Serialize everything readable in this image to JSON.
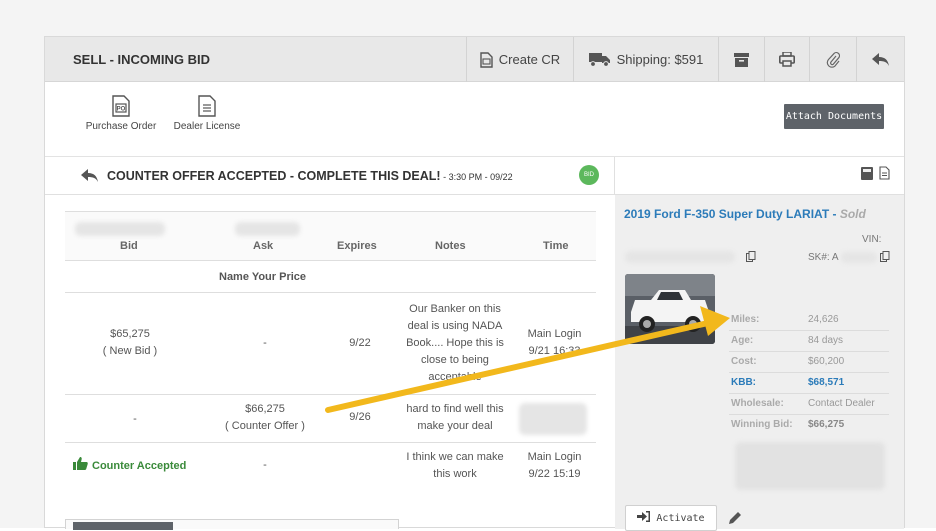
{
  "header": {
    "title": "SELL - INCOMING BID",
    "create_cr": "Create CR",
    "shipping": "Shipping: $591"
  },
  "docs": {
    "purchase_order": "Purchase Order",
    "dealer_license": "Dealer License",
    "attach": "Attach Documents"
  },
  "status": {
    "text": "COUNTER OFFER ACCEPTED - COMPLETE THIS DEAL!",
    "time": " - 3:30 PM - 09/22",
    "badge": "BID"
  },
  "table": {
    "columns": [
      "Bid",
      "Ask",
      "Expires",
      "Notes",
      "Time"
    ],
    "name_your_price": "Name Your Price",
    "rows": [
      {
        "bid": "$65,275",
        "bid_sub": "( New Bid )",
        "ask": "-",
        "expires": "9/22",
        "notes": [
          "Our Banker on this",
          "deal is using NADA",
          "Book.... Hope this is",
          "close to being",
          "acceptable"
        ],
        "time": [
          "Main Login",
          "9/21 16:33"
        ]
      },
      {
        "bid": "-",
        "ask": "$66,275",
        "ask_sub": "( Counter Offer )",
        "expires": "9/26",
        "notes": [
          "hard to find well this",
          "make your deal"
        ],
        "time": []
      },
      {
        "bid": "Counter Accepted",
        "ask": "-",
        "expires": "",
        "notes": [
          "I think we can make",
          "this work"
        ],
        "time": [
          "Main Login",
          "9/22 15:19"
        ]
      }
    ]
  },
  "vehicle": {
    "title": "2019 Ford F-350 Super Duty LARIAT",
    "sep": " - ",
    "status": "Sold",
    "vin_label": "VIN:",
    "sk_label": "SK#:",
    "sk_value": "A",
    "specs": [
      {
        "k": "Miles:",
        "v": "24,626"
      },
      {
        "k": "Age:",
        "v": "84 days"
      },
      {
        "k": "Cost:",
        "v": "$60,200"
      },
      {
        "k": "KBB:",
        "v": "$68,571"
      },
      {
        "k": "Wholesale:",
        "v": "Contact Dealer"
      },
      {
        "k": "Winning Bid:",
        "v": "$66,275"
      }
    ],
    "activate": "Activate"
  },
  "colors": {
    "accent_blue": "#2b7bb9",
    "accept_green": "#3a8a3a",
    "arrow_yellow": "#f2b81c",
    "button_dark": "#5e6369"
  }
}
